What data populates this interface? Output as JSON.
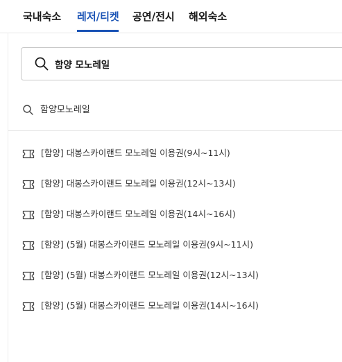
{
  "tabs": [
    {
      "label": "국내숙소",
      "active": false
    },
    {
      "label": "레저/티켓",
      "active": true
    },
    {
      "label": "공연/전시",
      "active": false
    },
    {
      "label": "해외숙소",
      "active": false
    }
  ],
  "search": {
    "value": "함양 모노레일",
    "icon": "search-icon"
  },
  "suggestion": {
    "label": "함양모노레일",
    "icon": "search-icon"
  },
  "results": [
    {
      "label": "[함양] 대봉스카이랜드 모노레일 이용권(9시~11시)",
      "icon": "ticket-icon"
    },
    {
      "label": "[함양] 대봉스카이랜드 모노레일 이용권(12시~13시)",
      "icon": "ticket-icon"
    },
    {
      "label": "[함양] 대봉스카이랜드 모노레일 이용권(14시~16시)",
      "icon": "ticket-icon"
    },
    {
      "label": "[함양] (5월) 대봉스카이랜드 모노레일 이용권(9시~11시)",
      "icon": "ticket-icon"
    },
    {
      "label": "[함양] (5월) 대봉스카이랜드 모노레일 이용권(12시~13시)",
      "icon": "ticket-icon"
    },
    {
      "label": "[함양] (5월) 대봉스카이랜드 모노레일 이용권(14시~16시)",
      "icon": "ticket-icon"
    }
  ],
  "colors": {
    "accent": "#1a53b5",
    "text": "#1a1a1a",
    "muted_text": "#333333",
    "divider": "#e6e6e6"
  }
}
